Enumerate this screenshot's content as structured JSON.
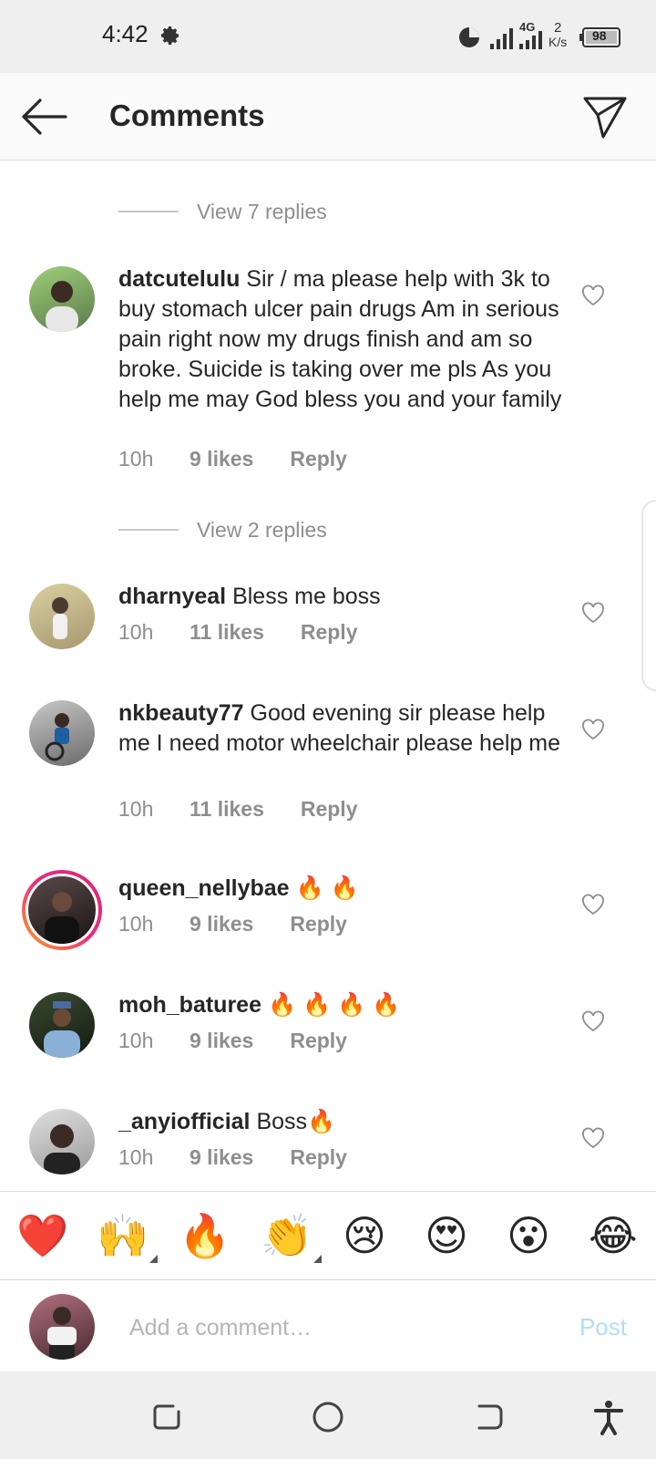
{
  "status_bar": {
    "time": "4:42",
    "network_type": "4G",
    "speed_value": "2",
    "speed_unit": "K/s",
    "battery": "98"
  },
  "header": {
    "title": "Comments"
  },
  "view_replies": [
    {
      "label": "View 7 replies"
    },
    {
      "label": "View 2 replies"
    }
  ],
  "comments": [
    {
      "username": "datcutelulu",
      "text": "Sir / ma please help with 3k to buy stomach ulcer pain drugs Am in serious pain right now my drugs finish and am so broke. Suicide is taking over me pls As you help me may God bless you and your family",
      "time": "10h",
      "likes": "9 likes",
      "reply": "Reply"
    },
    {
      "username": "dharnyeal",
      "text": "Bless me boss",
      "time": "10h",
      "likes": "11 likes",
      "reply": "Reply"
    },
    {
      "username": "nkbeauty77",
      "text": "Good evening sir please help me I need motor wheelchair please help me",
      "time": "10h",
      "likes": "11 likes",
      "reply": "Reply"
    },
    {
      "username": "queen_nellybae",
      "text": "🔥 🔥",
      "time": "10h",
      "likes": "9 likes",
      "reply": "Reply"
    },
    {
      "username": "moh_baturee",
      "text": "🔥 🔥 🔥 🔥",
      "time": "10h",
      "likes": "9 likes",
      "reply": "Reply"
    },
    {
      "username": "_anyiofficial",
      "text": "Boss🔥",
      "time": "10h",
      "likes": "9 likes",
      "reply": "Reply"
    }
  ],
  "reactions": [
    "❤️",
    "🙌",
    "🔥",
    "👏",
    "😢",
    "😍",
    "😮",
    "😂"
  ],
  "composer": {
    "placeholder": "Add a comment…",
    "post_label": "Post"
  },
  "colors": {
    "accent_disabled": "#b3dbff",
    "muted_text": "#8e8e8e",
    "story_ring": "#ee2a7b"
  }
}
